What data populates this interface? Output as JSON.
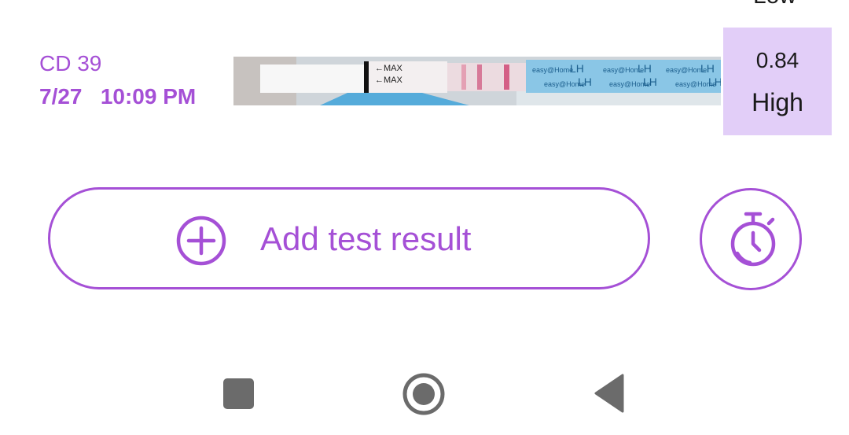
{
  "top_cutoff_label": "Low",
  "entry": {
    "cycle_day": "CD 39",
    "date": "7/27",
    "time": "10:09 PM",
    "datetime": "7/27   10:09 PM",
    "result": {
      "value": "0.84",
      "level": "High"
    },
    "strip": {
      "max_labels": [
        "←MAX",
        "←MAX"
      ],
      "brand_text": "easy@Home",
      "lh_text": "LH"
    }
  },
  "actions": {
    "add_result_label": "Add test result",
    "add_icon": "plus-circle-icon",
    "timer_icon": "timer-icon"
  },
  "navbar": {
    "recents_icon": "square-icon",
    "home_icon": "circle-icon",
    "back_icon": "triangle-back-icon"
  },
  "colors": {
    "accent": "#a550d6",
    "result_bg": "#e2cef8",
    "nav_icon": "#6b6b6b"
  }
}
